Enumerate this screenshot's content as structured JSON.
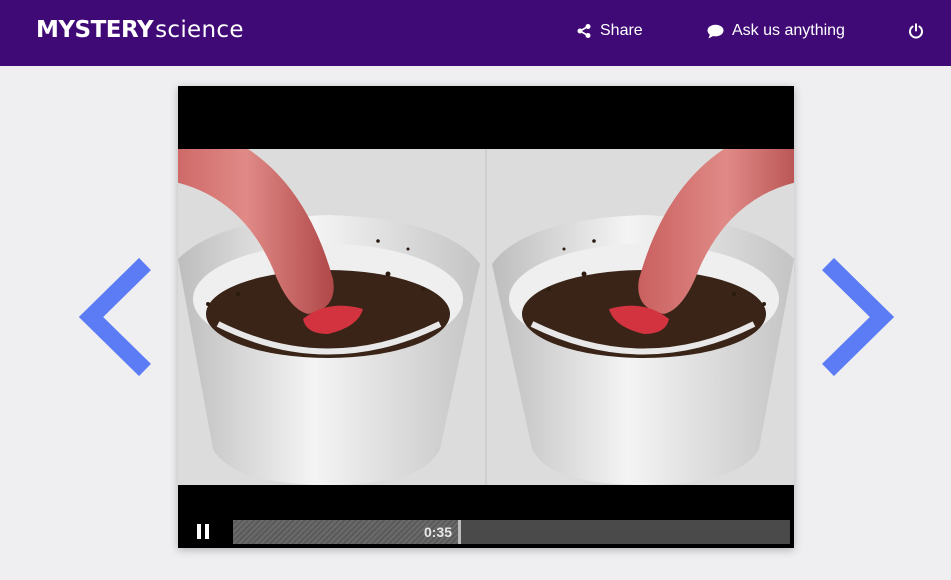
{
  "header": {
    "logo_bold": "MYSTERY",
    "logo_light": "science",
    "share_label": "Share",
    "ask_label": "Ask us anything",
    "share_icon": "share-icon",
    "ask_icon": "speech-bubble-icon",
    "power_icon": "power-icon",
    "background_color": "#3f0a76"
  },
  "player": {
    "current_time": "0:35",
    "progress": 0.41,
    "state": "playing",
    "pause_icon": "pause-icon"
  },
  "navigation": {
    "prev_icon": "chevron-left-icon",
    "next_icon": "chevron-right-icon",
    "arrow_color": "#5b7cf5"
  }
}
